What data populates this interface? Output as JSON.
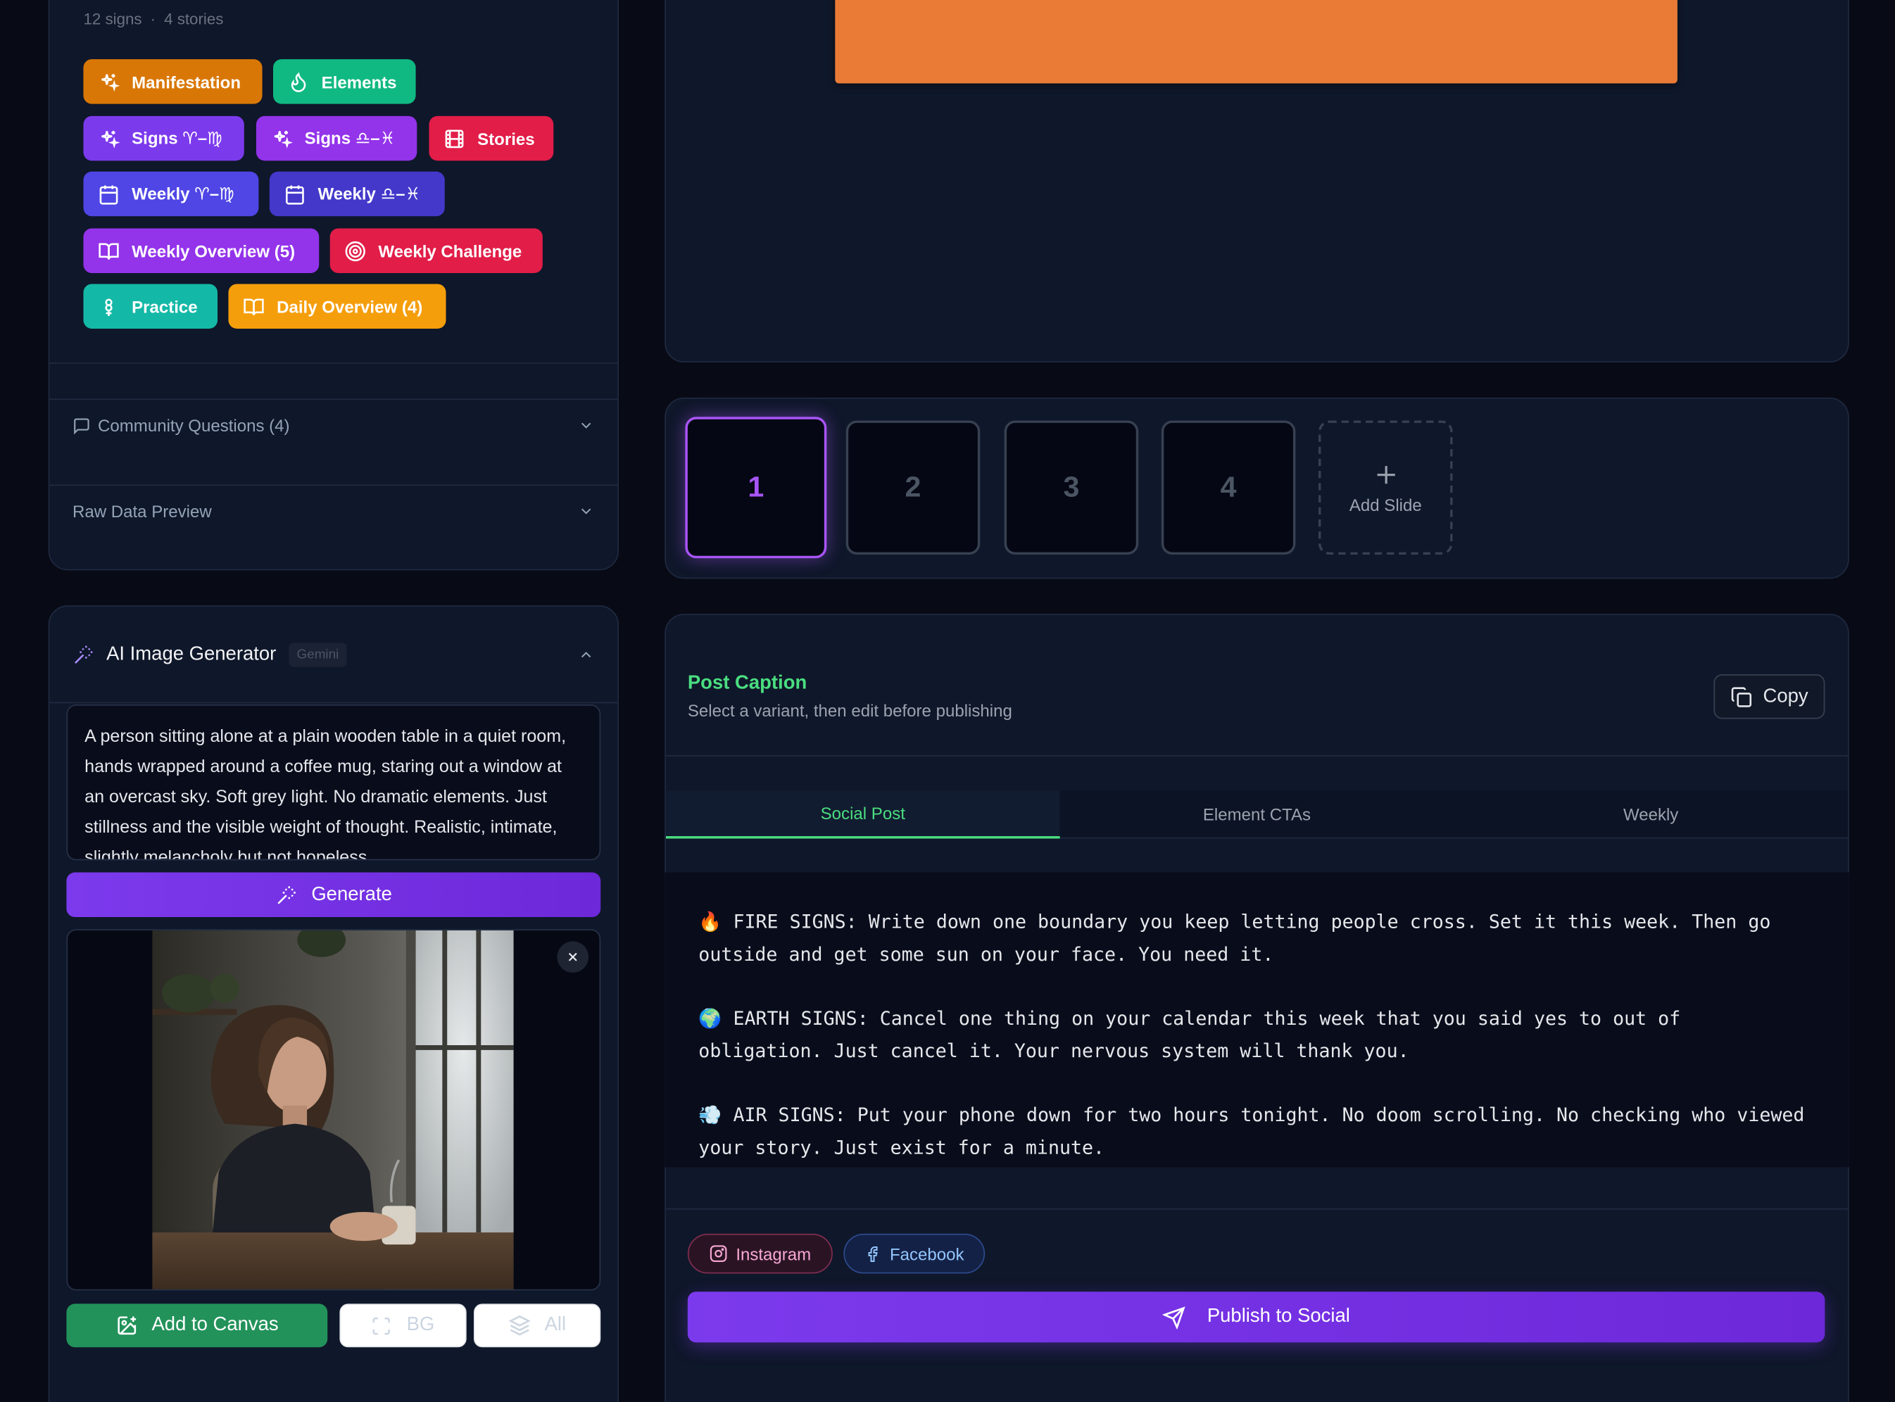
{
  "left_top": {
    "counts": {
      "signs": "12 signs",
      "stories": "4 stories"
    },
    "tags": [
      {
        "label": "Manifestation",
        "icon": "sparkle-icon",
        "color": "#d97706"
      },
      {
        "label": "Elements",
        "icon": "flame-icon",
        "color": "#10b981"
      },
      {
        "label": "Signs ♈–♍",
        "icon": "sparkle-icon",
        "color": "#7c3aed"
      },
      {
        "label": "Signs ♎–♓",
        "icon": "sparkle-icon",
        "color": "#9333ea"
      },
      {
        "label": "Stories",
        "icon": "film-icon",
        "color": "#e11d48"
      },
      {
        "label": "Weekly ♈–♍",
        "icon": "calendar-icon",
        "color": "#4f46e5"
      },
      {
        "label": "Weekly ♎–♓",
        "icon": "calendar-icon",
        "color": "#4338ca"
      },
      {
        "label": "Weekly Overview (5)",
        "icon": "book-icon",
        "color": "#9333ea"
      },
      {
        "label": "Weekly Challenge",
        "icon": "target-icon",
        "color": "#e11d48"
      },
      {
        "label": "Practice",
        "icon": "flower-icon",
        "color": "#14b8a6"
      },
      {
        "label": "Daily Overview (4)",
        "icon": "book-icon",
        "color": "#f59e0b"
      }
    ],
    "community_questions": "Community Questions (4)",
    "raw_data_preview": "Raw Data Preview"
  },
  "ai_generator": {
    "title": "AI Image Generator",
    "badge": "Gemini",
    "prompt": "A person sitting alone at a plain wooden table in a quiet room, hands wrapped around a coffee mug, staring out a window at an overcast sky. Soft grey light. No dramatic elements. Just stillness and the visible weight of thought. Realistic, intimate, slightly melancholy but not hopeless.",
    "generate_label": "Generate",
    "add_to_canvas_label": "Add to Canvas",
    "bg_label": "BG",
    "all_label": "All"
  },
  "slides": {
    "items": [
      "1",
      "2",
      "3",
      "4"
    ],
    "add_label": "Add Slide"
  },
  "post_caption": {
    "title": "Post Caption",
    "subtitle": "Select a variant, then edit before publishing",
    "copy_label": "Copy",
    "tabs": [
      "Social Post",
      "Element CTAs",
      "Weekly"
    ],
    "paragraphs": [
      "🔥 FIRE SIGNS: Write down one boundary you keep letting people cross. Set it this week. Then go outside and get some sun on your face. You need it.",
      "🌍 EARTH SIGNS: Cancel one thing on your calendar this week that you said yes to out of obligation. Just cancel it. Your nervous system will thank you.",
      "💨 AIR SIGNS: Put your phone down for two hours tonight. No doom scrolling. No checking who viewed your story. Just exist for a minute."
    ],
    "platforms": [
      "Instagram",
      "Facebook"
    ],
    "publish_label": "Publish to Social"
  },
  "colors": {
    "accent": "#7c3aed",
    "green": "#4ade80",
    "orange": "#ea7a38"
  }
}
